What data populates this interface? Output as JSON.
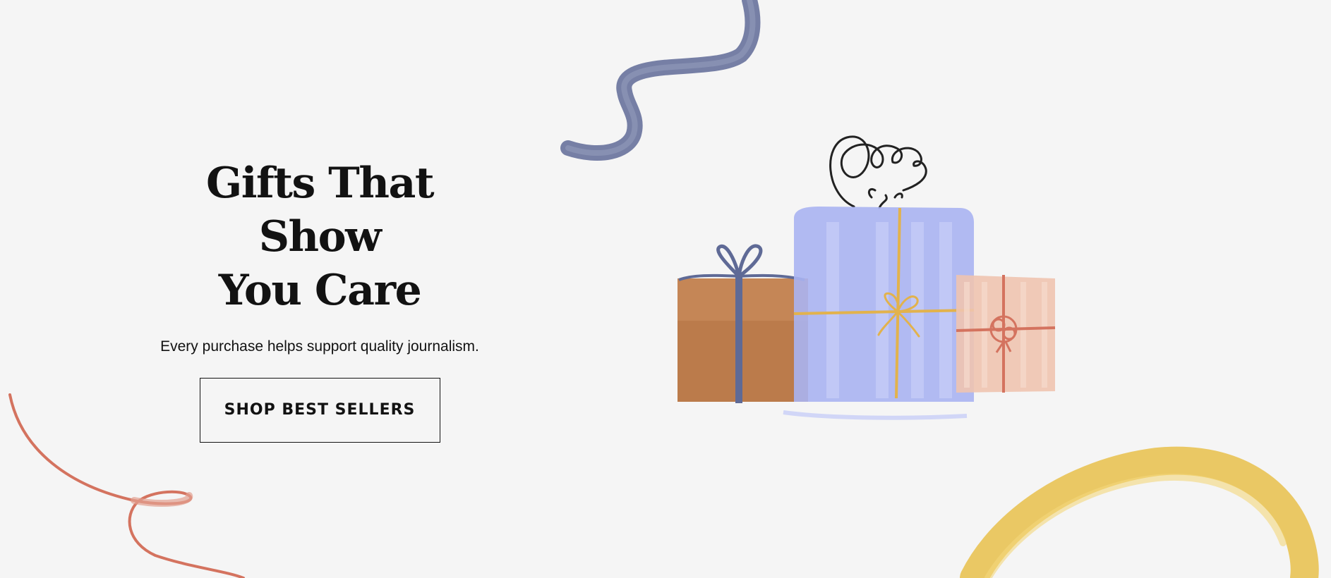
{
  "hero": {
    "headline_line1": "Gifts That Show",
    "headline_line2": "You Care",
    "subhead": "Every purchase helps support quality journalism.",
    "cta_label": "SHOP BEST SELLERS"
  },
  "illustration": {
    "icons": [
      "navy-ribbon-icon",
      "red-ribbon-icon",
      "yellow-ribbon-icon",
      "gift-boxes-icon"
    ],
    "colors": {
      "background": "#f5f5f5",
      "text": "#121212",
      "navy_ribbon": "#5f6a96",
      "red_ribbon": "#d4735f",
      "yellow_ribbon": "#e8c04a",
      "brown_box": "#c07a45",
      "blue_box": "#aab4f2",
      "pink_box": "#f0c4b0",
      "gold_string": "#e2b24c"
    }
  }
}
